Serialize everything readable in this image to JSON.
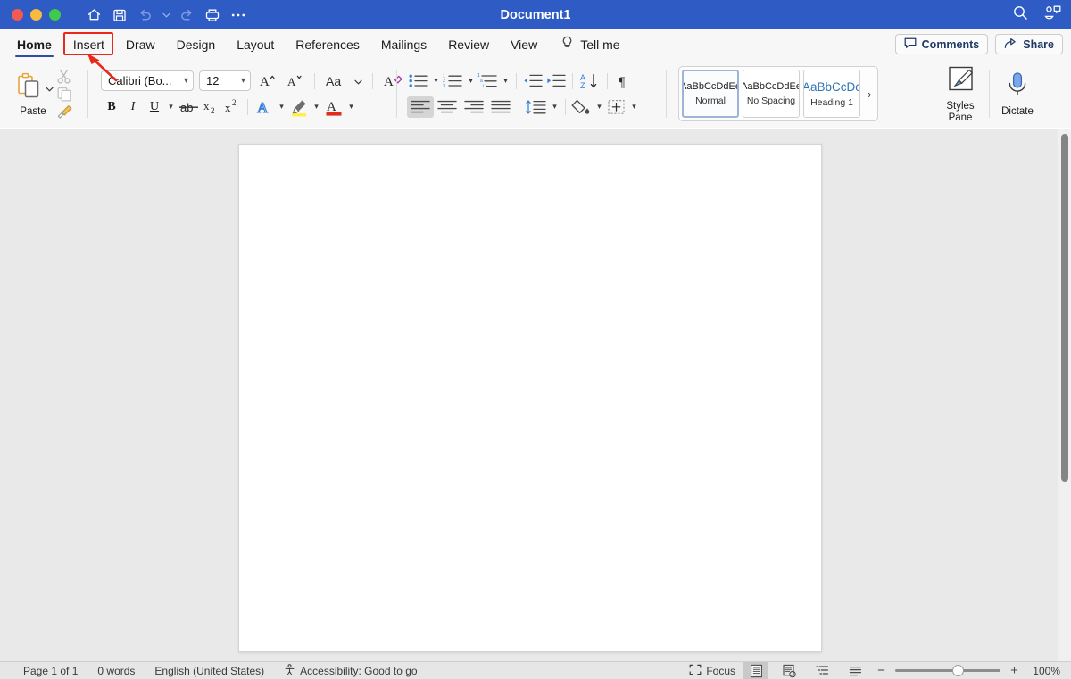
{
  "window": {
    "title": "Document1",
    "traffic_lights": [
      "close",
      "minimize",
      "maximize"
    ],
    "quick_access": [
      {
        "name": "home-icon",
        "label": "Home"
      },
      {
        "name": "save-icon",
        "label": "Save"
      },
      {
        "name": "undo-icon",
        "label": "Undo"
      },
      {
        "name": "redo-icon",
        "label": "Redo"
      },
      {
        "name": "print-icon",
        "label": "Print"
      },
      {
        "name": "more-icon",
        "label": "More"
      }
    ],
    "right_icons": [
      {
        "name": "search-icon",
        "label": "Search"
      },
      {
        "name": "ribbon-display-icon",
        "label": "Ribbon Display Options"
      }
    ]
  },
  "tabs": [
    {
      "label": "Home",
      "active": true
    },
    {
      "label": "Insert",
      "active": false
    },
    {
      "label": "Draw",
      "active": false
    },
    {
      "label": "Design",
      "active": false
    },
    {
      "label": "Layout",
      "active": false
    },
    {
      "label": "References",
      "active": false
    },
    {
      "label": "Mailings",
      "active": false
    },
    {
      "label": "Review",
      "active": false
    },
    {
      "label": "View",
      "active": false
    }
  ],
  "tell_me": {
    "label": "Tell me",
    "icon": "lightbulb-icon"
  },
  "header_buttons": [
    {
      "label": "Comments",
      "icon": "comment-icon"
    },
    {
      "label": "Share",
      "icon": "share-icon"
    }
  ],
  "ribbon": {
    "clipboard": {
      "paste_label": "Paste",
      "cut_label": "Cut",
      "copy_label": "Copy",
      "format_painter_label": "Format Painter"
    },
    "font": {
      "font_name": "Calibri (Bo...",
      "font_size": "12",
      "grow_label": "Grow Font",
      "shrink_label": "Shrink Font",
      "change_case_label": "Change Case",
      "clear_formatting_label": "Clear All Formatting",
      "bold_label": "B",
      "italic_label": "I",
      "underline_label": "U",
      "strikethrough_label": "Strikethrough",
      "subscript_label": "x₂",
      "superscript_label": "x²",
      "text_effects_label": "Text Effects",
      "highlight_label": "Text Highlight Color",
      "font_color_label": "Font Color"
    },
    "paragraph": {
      "bullets_label": "Bullets",
      "numbering_label": "Numbering",
      "multilevel_label": "Multilevel List",
      "decrease_indent_label": "Decrease Indent",
      "increase_indent_label": "Increase Indent",
      "sort_label": "Sort",
      "show_marks_label": "Show/Hide ¶",
      "align_left_label": "Align Left",
      "align_center_label": "Center",
      "align_right_label": "Align Right",
      "justify_label": "Justify",
      "line_spacing_label": "Line and Paragraph Spacing",
      "shading_label": "Shading",
      "borders_label": "Borders",
      "active_alignment": "Align Left"
    },
    "styles": {
      "items": [
        {
          "preview": "AaBbCcDdEe",
          "name": "Normal",
          "selected": true
        },
        {
          "preview": "AaBbCcDdEe",
          "name": "No Spacing",
          "selected": false
        },
        {
          "preview": "AaBbCcDc",
          "name": "Heading 1",
          "selected": false
        }
      ],
      "more_label": "›",
      "pane_label_line1": "Styles",
      "pane_label_line2": "Pane"
    },
    "dictate": {
      "label": "Dictate",
      "icon": "microphone-icon"
    }
  },
  "document": {
    "page_count": 1
  },
  "status_bar": {
    "page": "Page 1 of 1",
    "words": "0 words",
    "language": "English (United States)",
    "accessibility": "Accessibility: Good to go",
    "focus": "Focus",
    "views": [
      {
        "name": "print-layout-view",
        "label": "Print Layout",
        "active": true
      },
      {
        "name": "web-layout-view",
        "label": "Web Layout",
        "active": false
      },
      {
        "name": "outline-view",
        "label": "Outline",
        "active": false
      },
      {
        "name": "draft-view",
        "label": "Draft",
        "active": false
      }
    ],
    "zoom_out_label": "−",
    "zoom_in_label": "+",
    "zoom_level": "100%"
  },
  "annotation": {
    "target_tab": "Insert",
    "color": "#e8291c",
    "shape": "rectangle-with-arrow"
  },
  "colors": {
    "titlebar": "#2f5bc5",
    "ribbon_bg": "#f7f7f7",
    "canvas_bg": "#e9e9e9",
    "accent_underline": "#2b4f9e",
    "heading_blue": "#2e74b5",
    "annotation_red": "#e8291c"
  }
}
